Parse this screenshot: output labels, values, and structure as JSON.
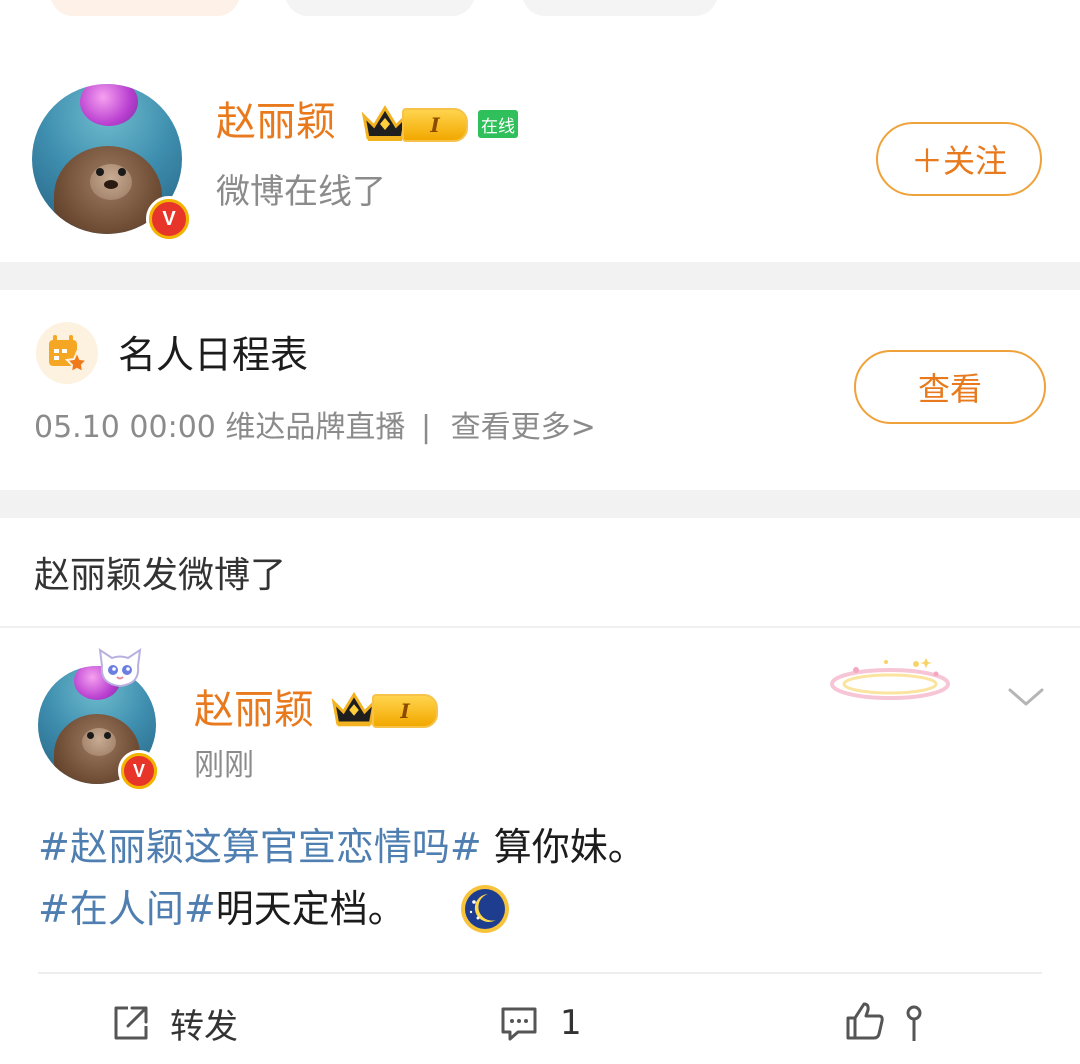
{
  "profile": {
    "name": "赵丽颖",
    "level": "I",
    "online_tag": "在线",
    "status": "微博在线了",
    "follow_button": "＋关注",
    "verified_badge": "V"
  },
  "schedule": {
    "title": "名人日程表",
    "event": "05.10 00:00 维达品牌直播",
    "separator": "|",
    "more_link": "查看更多>",
    "view_button": "查看"
  },
  "feed": {
    "header": "赵丽颖发微博了"
  },
  "post": {
    "author": "赵丽颖",
    "level": "I",
    "verified_badge": "V",
    "time": "刚刚",
    "line1_tag": "#赵丽颖这算官宣恋情吗#",
    "line1_text": " 算你妹。",
    "line2_tag": "#在人间#",
    "line2_text": "明天定档。",
    "actions": {
      "repost_label": "转发",
      "comment_count": "1"
    }
  },
  "colors": {
    "accent_orange": "#e8791c",
    "link_blue": "#4f7eb0",
    "online_green": "#2fbf5b",
    "divider": "#f2f2f2"
  },
  "icons": [
    "crown-icon",
    "verified-v-icon",
    "calendar-star-icon",
    "chevron-down-icon",
    "moon-emoji-icon",
    "repost-icon",
    "comment-icon",
    "like-icon"
  ]
}
